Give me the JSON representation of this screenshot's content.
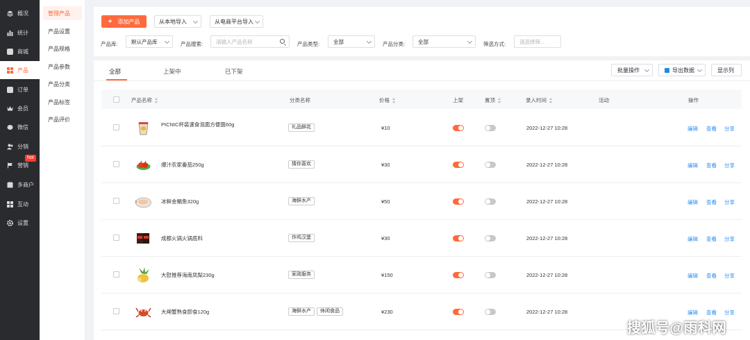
{
  "sidebar": {
    "items": [
      {
        "label": "概况",
        "icon": "layers-icon"
      },
      {
        "label": "统计",
        "icon": "bar-chart-icon"
      },
      {
        "label": "商城",
        "icon": "store-icon"
      },
      {
        "label": "产品",
        "icon": "grid-icon",
        "active": true
      },
      {
        "label": "订单",
        "icon": "order-icon"
      },
      {
        "label": "会员",
        "icon": "crown-icon"
      },
      {
        "label": "微信",
        "icon": "wechat-icon"
      },
      {
        "label": "分销",
        "icon": "users-icon"
      },
      {
        "label": "营销",
        "icon": "flag-icon"
      },
      {
        "label": "多商户",
        "icon": "shop-icon"
      },
      {
        "label": "互动",
        "icon": "apps-icon"
      },
      {
        "label": "设置",
        "icon": "gear-icon"
      }
    ],
    "hot_badge": "hot"
  },
  "submenu": {
    "items": [
      "管理产品",
      "产品设置",
      "产品规格",
      "产品参数",
      "产品分类",
      "产品标签",
      "产品评价"
    ]
  },
  "toolbar": {
    "add_label": "添加产品",
    "local_import": "从本地导入",
    "platform_import": "从电商平台导入"
  },
  "filters": {
    "library_label": "产品库:",
    "library_value": "默认产品库",
    "search_label": "产品搜索:",
    "search_placeholder": "请输入产品名称",
    "type_label": "产品类型:",
    "type_value": "全部",
    "category_label": "产品分类:",
    "category_value": "全部",
    "filter_label": "筛选方式:",
    "filter_placeholder": "请选择筛..."
  },
  "tabs": [
    "全部",
    "上架中",
    "已下架"
  ],
  "actions": {
    "batch": "批量操作",
    "export": "导出数据",
    "columns": "显示列"
  },
  "table": {
    "headers": {
      "name": "产品名称",
      "category": "分类名称",
      "price": "价格",
      "listed": "上架",
      "pinned": "置顶",
      "time": "录入时间",
      "activity": "活动",
      "ops": "操作"
    },
    "op_labels": [
      "编辑",
      "查看",
      "分享"
    ],
    "rows": [
      {
        "name": "PICNIC杯装速食泡面方便面60g",
        "tags": [
          "礼品鲜花"
        ],
        "price": "¥10",
        "listed": true,
        "pinned": false,
        "time": "2022-12-27 10:28"
      },
      {
        "name": "爆汁农家番茄250g",
        "tags": [
          "猜你喜欢"
        ],
        "price": "¥30",
        "listed": true,
        "pinned": false,
        "time": "2022-12-27 10:28"
      },
      {
        "name": "冰鲜金鲳鱼320g",
        "tags": [
          "海鲜水产"
        ],
        "price": "¥50",
        "listed": true,
        "pinned": false,
        "time": "2022-12-27 10:28"
      },
      {
        "name": "成都火锅火锅底料",
        "tags": [
          "炸鸡汉堡"
        ],
        "price": "¥30",
        "listed": true,
        "pinned": false,
        "time": "2022-12-27 10:28"
      },
      {
        "name": "大慰推荐海南凤梨230g",
        "tags": [
          "家政服务"
        ],
        "price": "¥150",
        "listed": true,
        "pinned": false,
        "time": "2022-12-27 10:28"
      },
      {
        "name": "大闸蟹熟食即食120g",
        "tags": [
          "海鲜水产",
          "休闲食品"
        ],
        "price": "¥230",
        "listed": true,
        "pinned": false,
        "time": "2022-12-27 10:28"
      }
    ]
  },
  "watermark": "搜狐号@雨科网",
  "colors": {
    "accent": "#ff6a3d",
    "link": "#2d8cf0",
    "sidebar": "#2a2b2e"
  }
}
